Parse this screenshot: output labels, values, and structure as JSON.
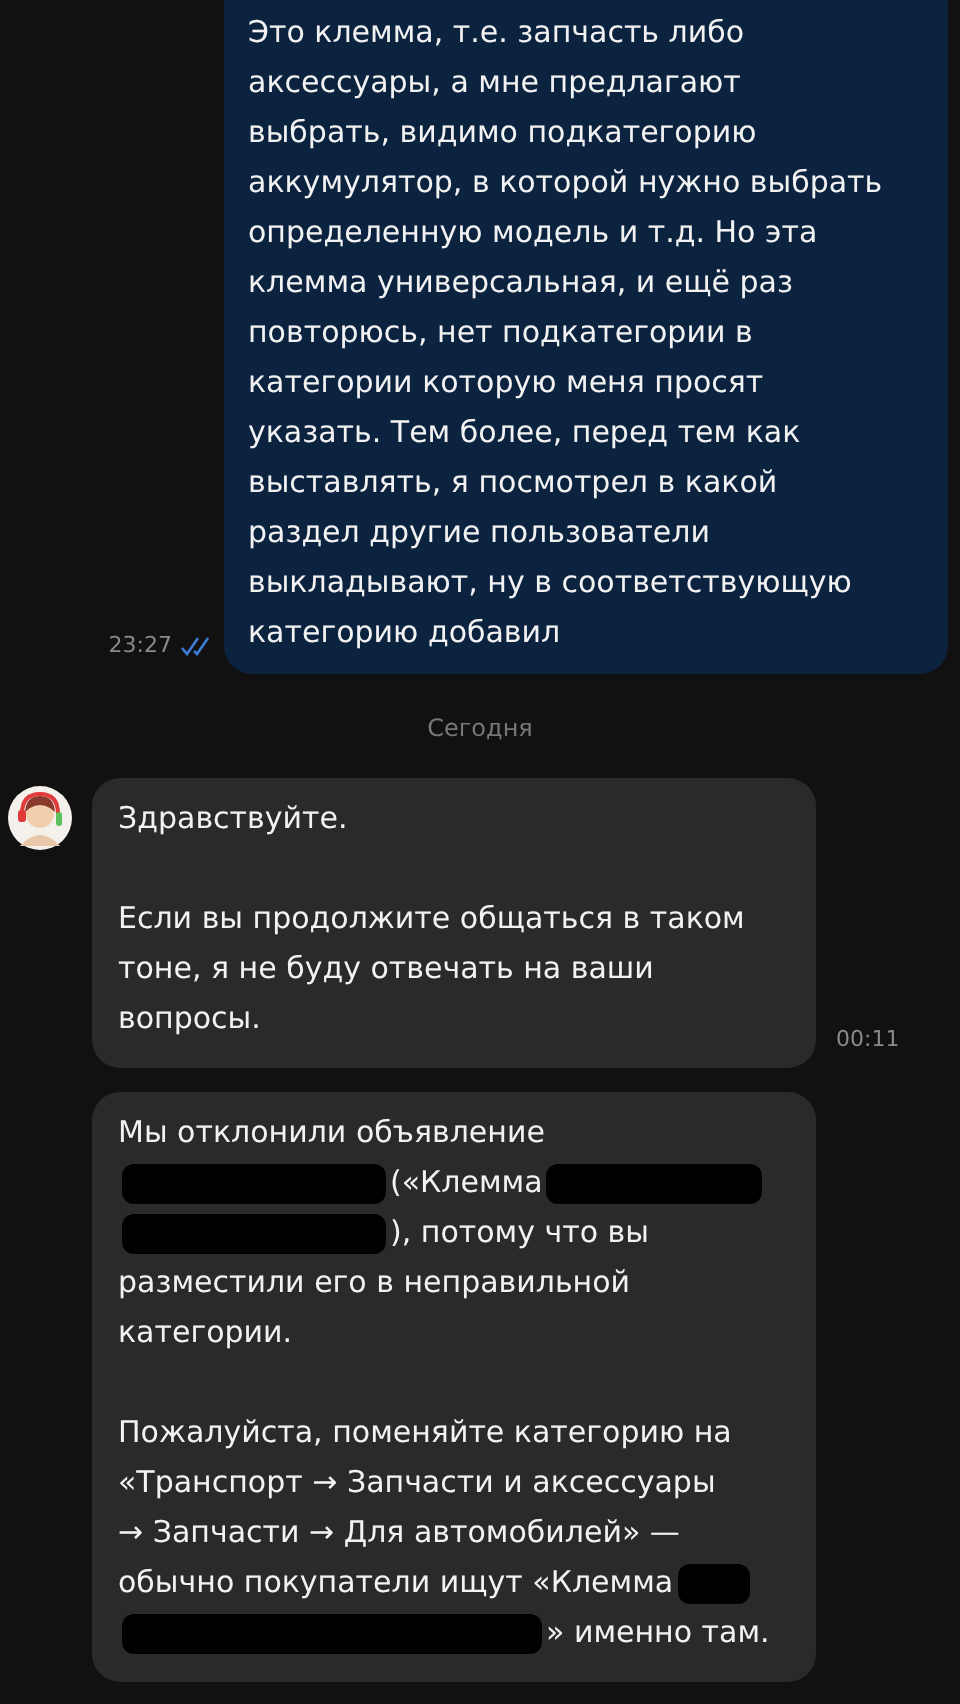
{
  "messages": [
    {
      "kind": "outgoing",
      "time": "23:27",
      "read": true,
      "paragraphs": [
        [
          [
            {
              "kind": "text",
              "text": "Это клемма, т.е. запчасть либо"
            }
          ],
          [
            {
              "kind": "text",
              "text": "аксессуары, а мне предлагают"
            }
          ],
          [
            {
              "kind": "text",
              "text": "выбрать, видимо подкатегорию"
            }
          ],
          [
            {
              "kind": "text",
              "text": "аккумулятор, в которой нужно выбрать"
            }
          ],
          [
            {
              "kind": "text",
              "text": "определенную модель и т.д. Но эта"
            }
          ],
          [
            {
              "kind": "text",
              "text": "клемма универсальная, и ещё раз"
            }
          ],
          [
            {
              "kind": "text",
              "text": "повторюсь, нет подкатегории в"
            }
          ],
          [
            {
              "kind": "text",
              "text": "категории которую меня просят"
            }
          ],
          [
            {
              "kind": "text",
              "text": "указать. Тем более, перед тем как"
            }
          ],
          [
            {
              "kind": "text",
              "text": "выставлять, я посмотрел в какой"
            }
          ],
          [
            {
              "kind": "text",
              "text": "раздел другие пользователи"
            }
          ],
          [
            {
              "kind": "text",
              "text": "выкладывают, ну в соответствующую"
            }
          ],
          [
            {
              "kind": "text",
              "text": "категорию добавил"
            }
          ]
        ]
      ]
    },
    {
      "kind": "divider",
      "text": "Сегодня"
    },
    {
      "kind": "incoming",
      "time": "00:11",
      "avatar": true,
      "paragraphs": [
        [
          [
            {
              "kind": "text",
              "text": "Здравствуйте."
            }
          ]
        ],
        [
          [
            {
              "kind": "text",
              "text": "Если вы продолжите общаться в таком"
            }
          ],
          [
            {
              "kind": "text",
              "text": "тоне, я не буду отвечать на ваши"
            }
          ],
          [
            {
              "kind": "text",
              "text": "вопросы."
            }
          ]
        ]
      ]
    },
    {
      "kind": "incoming",
      "avatar": false,
      "paragraphs": [
        [
          [
            {
              "kind": "text",
              "text": "Мы отклонили объявление"
            }
          ],
          [
            {
              "kind": "redacted_long"
            },
            {
              "kind": "text",
              "text": "(«Клемма"
            },
            {
              "kind": "redacted_medium"
            }
          ],
          [
            {
              "kind": "redacted_long"
            },
            {
              "kind": "text",
              "text": "), потому что вы"
            }
          ],
          [
            {
              "kind": "text",
              "text": "разместили его в неправильной"
            }
          ],
          [
            {
              "kind": "text",
              "text": "категории."
            }
          ]
        ],
        [
          [
            {
              "kind": "text",
              "text": "Пожалуйста, поменяйте категорию на"
            }
          ],
          [
            {
              "kind": "text",
              "text": "«Транспорт → Запчасти и аксессуары"
            }
          ],
          [
            {
              "kind": "text",
              "text": "→ Запчасти → Для автомобилей» —"
            }
          ],
          [
            {
              "kind": "text",
              "text": "обычно покупатели ищут «Клемма"
            },
            {
              "kind": "redacted_short"
            }
          ],
          [
            {
              "kind": "redacted_xlong"
            },
            {
              "kind": "text",
              "text": "» именно там."
            }
          ]
        ]
      ]
    }
  ]
}
